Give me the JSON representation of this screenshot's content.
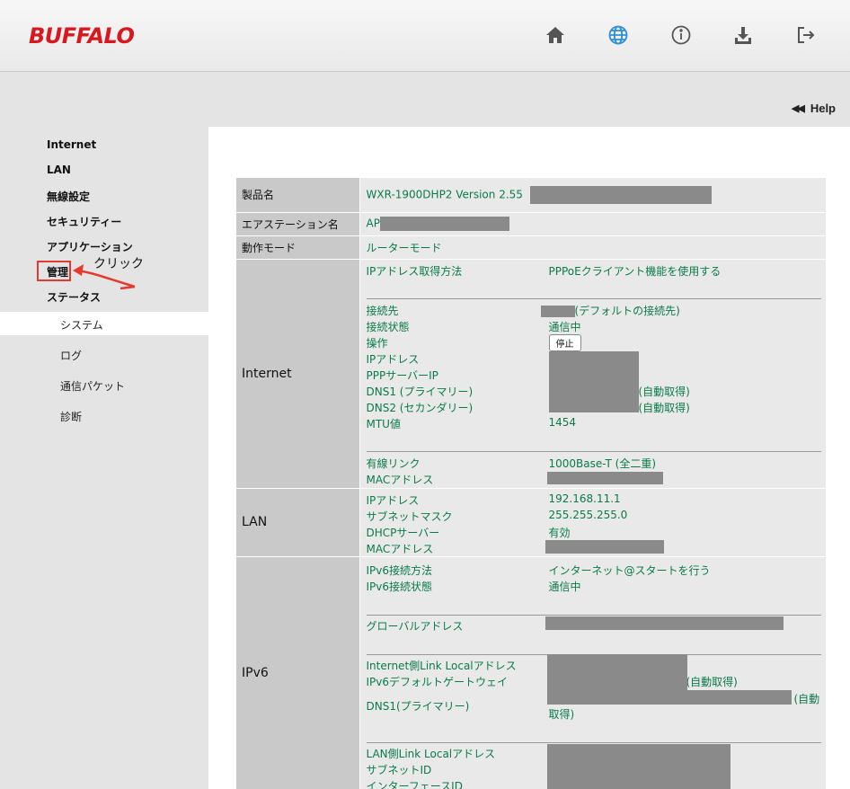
{
  "header": {
    "logo": "BUFFALO"
  },
  "icons": [
    "home-icon",
    "globe-icon",
    "info-icon",
    "download-icon",
    "logout-icon"
  ],
  "help": {
    "label": "Help"
  },
  "sidebar": {
    "items": [
      "Internet",
      "LAN",
      "無線設定",
      "セキュリティー",
      "アプリケーション",
      "管理",
      "ステータス"
    ],
    "sub_items": [
      "システム",
      "ログ",
      "通信パケット",
      "診断"
    ],
    "annotation": "クリック"
  },
  "status": {
    "product_label": "製品名",
    "product_value": "WXR-1900DHP2  Version 2.55",
    "station_label": "エアステーション名",
    "station_value": "AP",
    "mode_label": "動作モード",
    "mode_value": "ルーターモード",
    "internet": {
      "label": "Internet",
      "ip_method_label": "IPアドレス取得方法",
      "ip_method_value": "PPPoEクライアント機能を使用する",
      "dest_label": "接続先",
      "dest_value": "(デフォルトの接続先)",
      "state_label": "接続状態",
      "state_value": "通信中",
      "op_label": "操作",
      "op_button": "停止",
      "ip_label": "IPアドレス",
      "ppp_label": "PPPサーバーIP",
      "dns1_label": "DNS1 (プライマリー)",
      "dns1_suffix": "(自動取得)",
      "dns2_label": "DNS2 (セカンダリー)",
      "dns2_suffix": "(自動取得)",
      "mtu_label": "MTU値",
      "mtu_value": "1454",
      "link_label": "有線リンク",
      "link_value": "1000Base-T (全二重)",
      "mac_label": "MACアドレス"
    },
    "lan": {
      "label": "LAN",
      "ip_label": "IPアドレス",
      "ip_value": "192.168.11.1",
      "mask_label": "サブネットマスク",
      "mask_value": "255.255.255.0",
      "dhcp_label": "DHCPサーバー",
      "dhcp_value": "有効",
      "mac_label": "MACアドレス"
    },
    "ipv6": {
      "label": "IPv6",
      "method_label": "IPv6接続方法",
      "method_value": "インターネット@スタートを行う",
      "state_label": "IPv6接続状態",
      "state_value": "通信中",
      "global_label": "グローバルアドレス",
      "inet_ll_label": "Internet側Link Localアドレス",
      "gw_label": "IPv6デフォルトゲートウェイ",
      "gw_suffix": "(自動取得)",
      "dns1_label": "DNS1(プライマリー)",
      "dns1_suffix_a": "(自動",
      "dns1_suffix_b": "取得)",
      "lan_ll_label": "LAN側Link Localアドレス",
      "subnet_label": "サブネットID",
      "ifid_label": "インターフェースID"
    }
  }
}
